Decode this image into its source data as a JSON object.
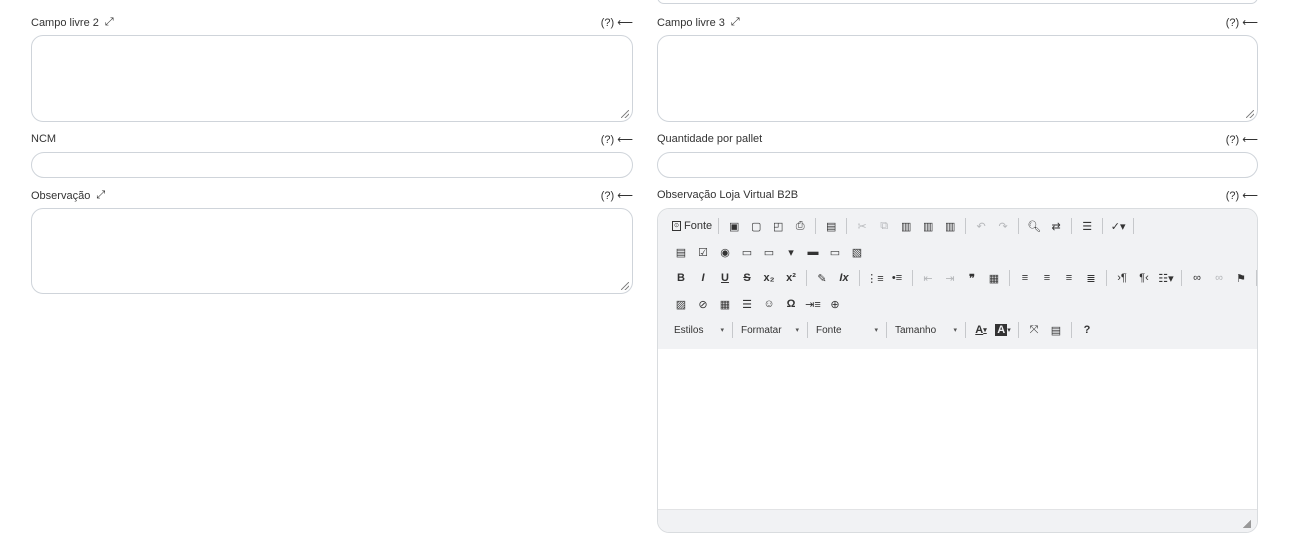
{
  "fields": {
    "campo2": {
      "label": "Campo livre 2",
      "help": "(?) ⟵"
    },
    "campo3": {
      "label": "Campo livre 3",
      "help": "(?) ⟵"
    },
    "ncm": {
      "label": "NCM",
      "help": "(?) ⟵"
    },
    "qtd": {
      "label": "Quantidade por pallet",
      "help": "(?) ⟵"
    },
    "obs": {
      "label": "Observação",
      "help": "(?) ⟵"
    },
    "obsb2b": {
      "label": "Observação Loja Virtual B2B",
      "help": "(?) ⟵"
    }
  },
  "editor": {
    "source_label": "Fonte",
    "combos": {
      "styles": "Estilos",
      "format": "Formatar",
      "font": "Fonte",
      "size": "Tamanho"
    },
    "glyphs": {
      "bold": "B",
      "italic": "I",
      "underline": "U",
      "strike": "S",
      "subscript": "x₂",
      "superscript": "x²",
      "remove_format": "Ix",
      "blockquote": "❞",
      "special_char": "Ω",
      "help": "?",
      "text_color": "A",
      "bg_color": "A"
    }
  }
}
